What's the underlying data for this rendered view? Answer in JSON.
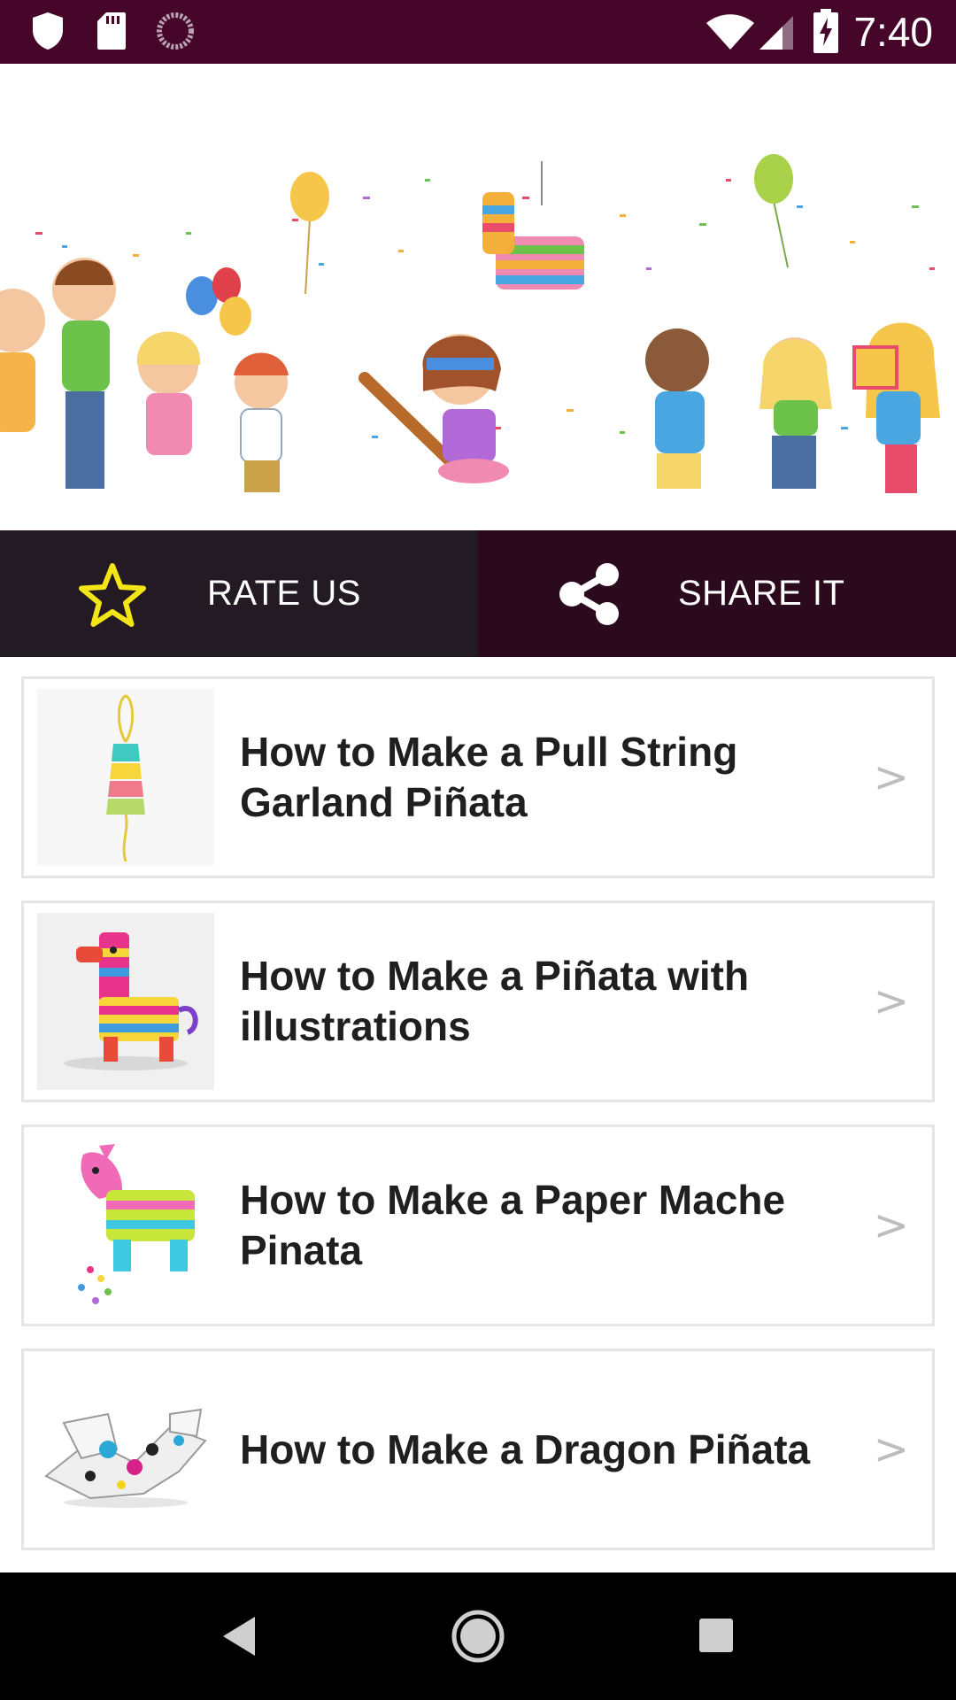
{
  "status_bar": {
    "time": "7:40",
    "left_icons": [
      "shield-icon",
      "sd-card-icon",
      "sync-circle-icon"
    ],
    "right_icons": [
      "wifi-icon",
      "cell-signal-icon",
      "battery-charging-icon"
    ]
  },
  "banner": {
    "alt": "party-kids-pinata-banner"
  },
  "actions": {
    "rate": {
      "label": "RATE US",
      "icon": "star-icon"
    },
    "share": {
      "label": "SHARE IT",
      "icon": "share-icon"
    }
  },
  "items": [
    {
      "title": "How to Make a Pull String Garland Piñata",
      "chevron": ">",
      "thumb": "pull-string-pinata-thumbnail"
    },
    {
      "title": "How to Make a Piñata with illustrations",
      "chevron": ">",
      "thumb": "llama-pinata-thumbnail"
    },
    {
      "title": "How to Make a Paper Mache Pinata",
      "chevron": ">",
      "thumb": "pink-horse-pinata-thumbnail"
    },
    {
      "title": "How to Make a Dragon Piñata",
      "chevron": ">",
      "thumb": "dragon-pinata-thumbnail"
    }
  ],
  "nav_bar": {
    "back": "back-icon",
    "home": "home-icon",
    "recents": "recents-icon"
  },
  "colors": {
    "status_bar": "#45062a",
    "rate_bg": "#231a24",
    "share_bg": "#2b0a1d",
    "star": "#f2e616",
    "card_border": "#e5e5e5",
    "title_text": "#1f1f1f"
  }
}
